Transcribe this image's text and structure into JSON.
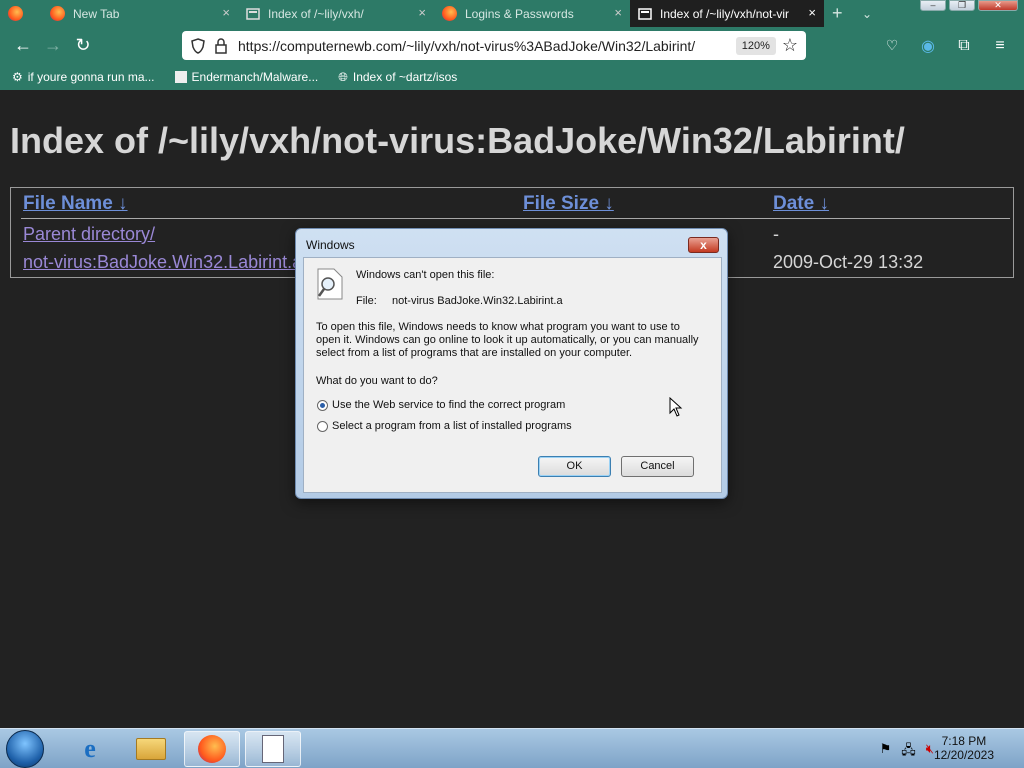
{
  "tabs": [
    {
      "title": "",
      "icon": "firefox-icon"
    },
    {
      "title": "New Tab",
      "icon": "firefox-icon"
    },
    {
      "title": "Index of /~lily/vxh/",
      "icon": "page-icon"
    },
    {
      "title": "Logins & Passwords",
      "icon": "firefox-icon"
    },
    {
      "title": "Index of /~lily/vxh/not-vir",
      "icon": "page-icon",
      "active": true
    }
  ],
  "url": "https://computernewb.com/~lily/vxh/not-virus%3ABadJoke/Win32/Labirint/",
  "zoom": "120%",
  "bookmarks": [
    {
      "label": "if youre gonna run ma..."
    },
    {
      "label": "Endermanch/Malware..."
    },
    {
      "label": "Index of ~dartz/isos"
    }
  ],
  "page": {
    "heading": "Index of /~lily/vxh/not-virus:BadJoke/Win32/Labirint/",
    "columns": [
      "File Name  ↓",
      "File Size  ↓",
      "Date  ↓"
    ],
    "rows": [
      {
        "name": "Parent directory/",
        "size": "",
        "date": "-"
      },
      {
        "name": "not-virus:BadJoke.Win32.Labirint.a",
        "size": "",
        "date": "2009-Oct-29 13:32"
      }
    ]
  },
  "dialog": {
    "title": "Windows",
    "close": "x",
    "heading": "Windows can't open this file:",
    "file_label": "File:",
    "file_name": "not-virus BadJoke.Win32.Labirint.a",
    "explain1": "To open this file, Windows needs to know what program you want to use to",
    "explain2": "open it. Windows can go online to look it up automatically, or you can manually",
    "explain3": "select from a list of programs that are installed on your computer.",
    "question": "What do you want to do?",
    "option1": "Use the Web service to find the correct program",
    "option2": "Select a program from a list of installed programs",
    "ok": "OK",
    "cancel": "Cancel"
  },
  "taskbar": {
    "time": "7:18 PM",
    "date": "12/20/2023"
  },
  "colors": {
    "accent": "#2d7a67",
    "page_bg": "#222222",
    "link": "#9a88d6",
    "header_link": "#6d8fd8"
  }
}
